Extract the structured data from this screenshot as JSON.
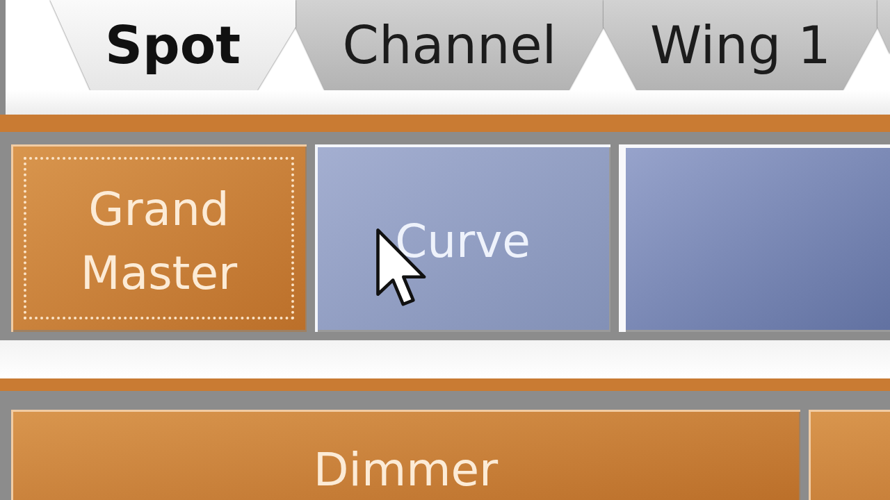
{
  "tabs": [
    {
      "label": "Spot",
      "selected": true
    },
    {
      "label": "Channel",
      "selected": false
    },
    {
      "label": "Wing 1",
      "selected": false
    },
    {
      "selected": false
    }
  ],
  "button_rows": [
    {
      "buttons": [
        {
          "label": "Grand Master",
          "active": true,
          "focused": true,
          "hovered": false
        },
        {
          "label": "Curve",
          "active": false,
          "focused": false,
          "hovered": true
        },
        {
          "active": false,
          "focused": false,
          "hovered": false
        }
      ]
    },
    {
      "buttons": [
        {
          "label": "Dimmer",
          "active": true,
          "focused": false,
          "hovered": false
        },
        {
          "active": true,
          "focused": false,
          "hovered": false
        }
      ]
    }
  ]
}
